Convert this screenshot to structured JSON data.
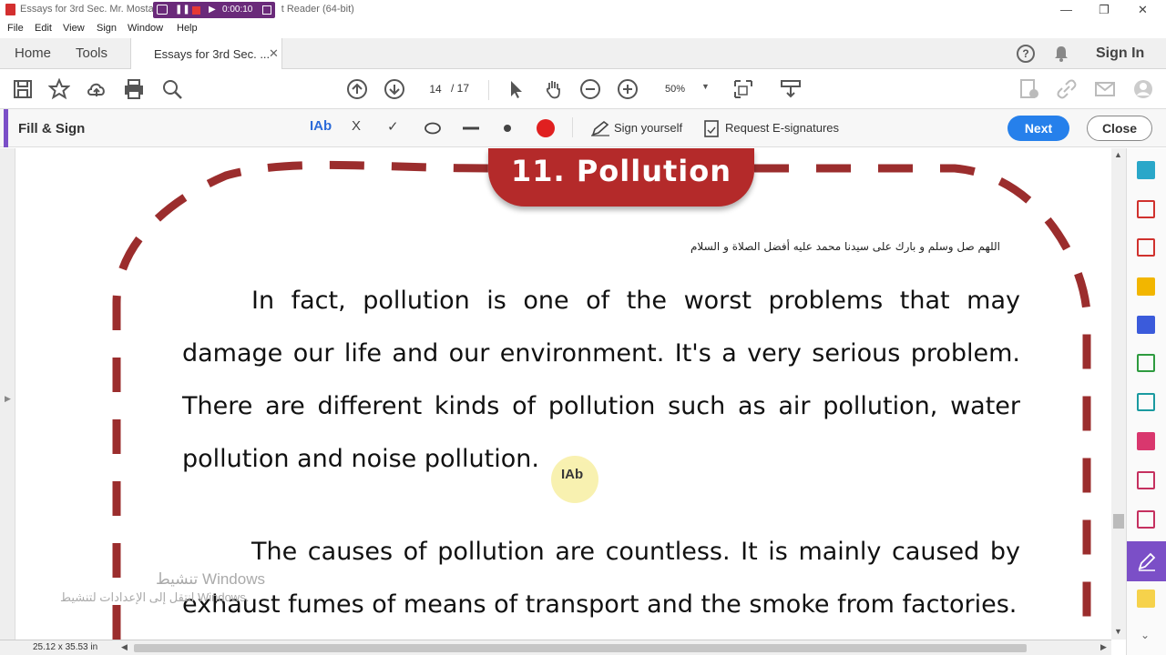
{
  "window": {
    "title": "Essays for 3rd Sec. Mr. Mosta",
    "title_suffix": "t Reader (64-bit)",
    "recorder_time": "0:00:10"
  },
  "menu": [
    "File",
    "Edit",
    "View",
    "Sign",
    "Window",
    "Help"
  ],
  "tabs": {
    "home": "Home",
    "tools": "Tools",
    "document": "Essays for 3rd Sec. ...",
    "sign_in": "Sign In"
  },
  "toolbar": {
    "current_page": "14",
    "total_pages": "/ 17",
    "zoom": "50%"
  },
  "fill_sign": {
    "title": "Fill & Sign",
    "text_tool": "IAb",
    "cross_tool": "X",
    "check_tool": "✓",
    "sign_yourself": "Sign yourself",
    "request_esig": "Request E-signatures",
    "next": "Next",
    "close": "Close",
    "color": "#e02020"
  },
  "document": {
    "title": "11. Pollution",
    "arabic_line": "اللهم صل وسلم و بارك على سيدنا محمد عليه أفضل الصلاة و السلام",
    "paragraph1": "In fact, pollution is one of the worst problems that may damage our life and our environment. It's a very serious problem. There are different kinds of pollution such as air pollution, water pollution and noise pollution.",
    "paragraph2": "The causes of pollution are countless. It is mainly caused by exhaust fumes of means of transport and the smoke from factories.",
    "cursor_label": "IAb",
    "border_color": "#9b2d2d"
  },
  "watermark": {
    "line1": "تنشيط Windows",
    "line2": "انتقل إلى الإعدادات لتنشيط Windows."
  },
  "status": {
    "page_size": "25.12 x 35.53 in"
  }
}
